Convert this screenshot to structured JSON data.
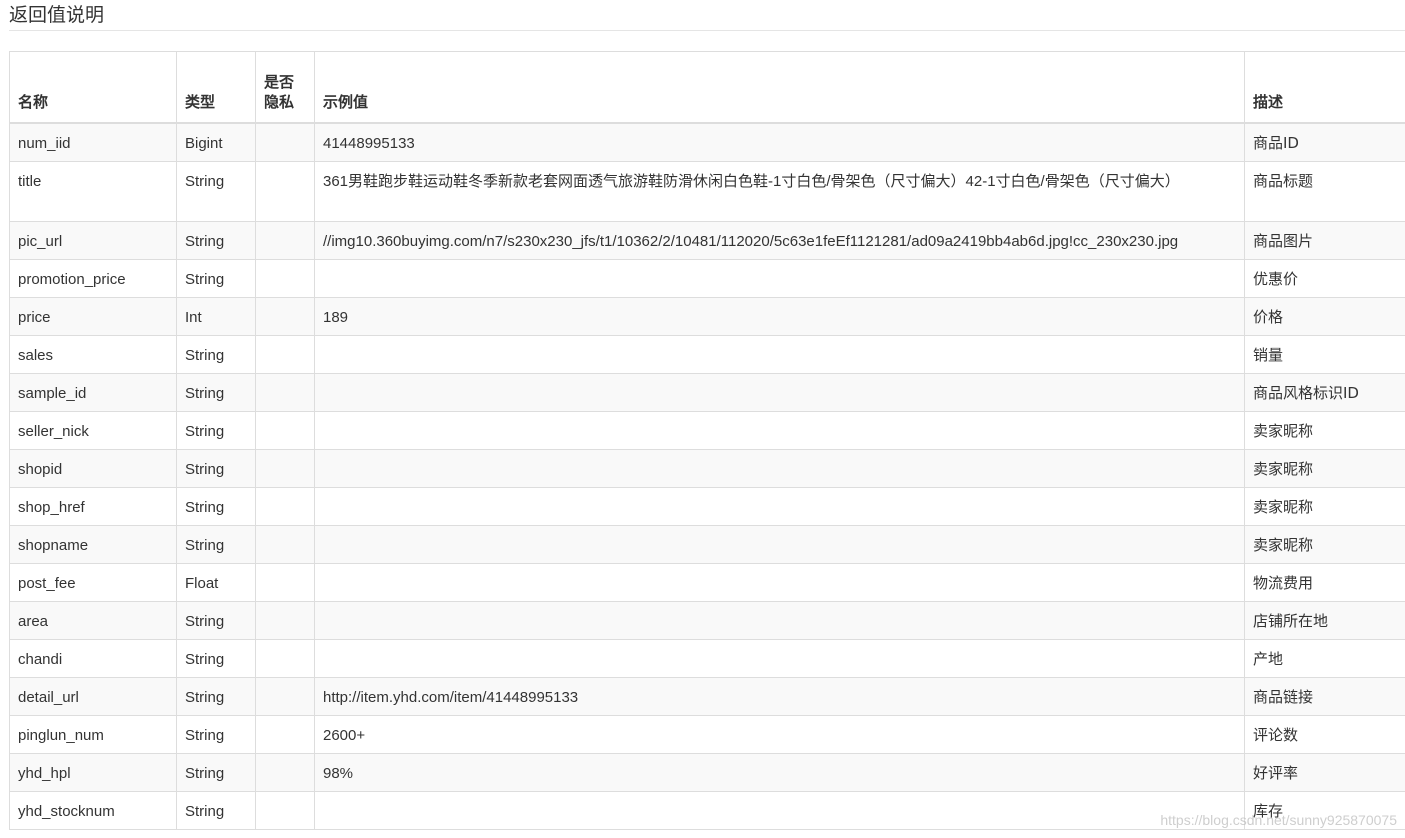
{
  "section_title": "返回值说明",
  "table": {
    "headers": {
      "name": "名称",
      "type": "类型",
      "private": "是否隐私",
      "example": "示例值",
      "description": "描述"
    },
    "rows": [
      {
        "name": "num_iid",
        "type": "Bigint",
        "private": "",
        "example": "41448995133",
        "description": "商品ID"
      },
      {
        "name": "title",
        "type": "String",
        "private": "",
        "example": "361男鞋跑步鞋运动鞋冬季新款老套网面透气旅游鞋防滑休闲白色鞋-1寸白色/骨架色（尺寸偏大）42-1寸白色/骨架色（尺寸偏大）",
        "description": "商品标题"
      },
      {
        "name": "pic_url",
        "type": "String",
        "private": "",
        "example": "//img10.360buyimg.com/n7/s230x230_jfs/t1/10362/2/10481/112020/5c63e1feEf1121281/ad09a2419bb4ab6d.jpg!cc_230x230.jpg",
        "description": "商品图片"
      },
      {
        "name": "promotion_price",
        "type": "String",
        "private": "",
        "example": "",
        "description": "优惠价"
      },
      {
        "name": "price",
        "type": "Int",
        "private": "",
        "example": "189",
        "description": "价格"
      },
      {
        "name": "sales",
        "type": "String",
        "private": "",
        "example": "",
        "description": "销量"
      },
      {
        "name": "sample_id",
        "type": "String",
        "private": "",
        "example": "",
        "description": "商品风格标识ID"
      },
      {
        "name": "seller_nick",
        "type": "String",
        "private": "",
        "example": "",
        "description": "卖家昵称"
      },
      {
        "name": "shopid",
        "type": "String",
        "private": "",
        "example": "",
        "description": "卖家昵称"
      },
      {
        "name": "shop_href",
        "type": "String",
        "private": "",
        "example": "",
        "description": "卖家昵称"
      },
      {
        "name": "shopname",
        "type": "String",
        "private": "",
        "example": "",
        "description": "卖家昵称"
      },
      {
        "name": "post_fee",
        "type": "Float",
        "private": "",
        "example": "",
        "description": "物流费用"
      },
      {
        "name": "area",
        "type": "String",
        "private": "",
        "example": "",
        "description": "店铺所在地"
      },
      {
        "name": "chandi",
        "type": "String",
        "private": "",
        "example": "",
        "description": "产地"
      },
      {
        "name": "detail_url",
        "type": "String",
        "private": "",
        "example": "http://item.yhd.com/item/41448995133",
        "description": "商品链接"
      },
      {
        "name": "pinglun_num",
        "type": "String",
        "private": "",
        "example": "2600+",
        "description": "评论数"
      },
      {
        "name": "yhd_hpl",
        "type": "String",
        "private": "",
        "example": "98%",
        "description": "好评率"
      },
      {
        "name": "yhd_stocknum",
        "type": "String",
        "private": "",
        "example": "",
        "description": "库存"
      }
    ]
  },
  "watermark": "https://blog.csdn.net/sunny925870075"
}
